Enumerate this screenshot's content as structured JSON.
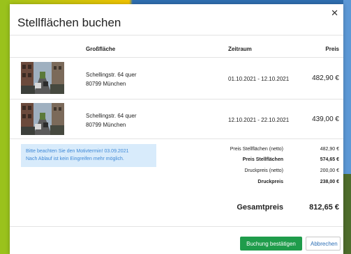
{
  "modal": {
    "title": "Stellflächen buchen",
    "close_icon": "close-icon"
  },
  "table": {
    "headers": {
      "area": "Großfläche",
      "period": "Zeitraum",
      "price": "Preis"
    },
    "rows": [
      {
        "address_line1": "Schellingstr. 64 quer",
        "address_line2": "80799 München",
        "period": "01.10.2021 - 12.10.2021",
        "price": "482,90 €",
        "image": "street-photo"
      },
      {
        "address_line1": "Schellingstr. 64 quer",
        "address_line2": "80799 München",
        "period": "12.10.2021 - 22.10.2021",
        "price": "439,00 €",
        "image": "street-photo"
      }
    ]
  },
  "notice": {
    "line1": "Bitte beachten Sie den Motivtermin! 03.09.2021",
    "line2": "Nach Ablauf ist kein Eingreifen mehr möglich."
  },
  "summary": [
    {
      "label": "Preis Stellflächen (netto)",
      "value": "482,90 €",
      "bold": false
    },
    {
      "label": "Preis Stellflächen",
      "value": "574,65 €",
      "bold": true
    },
    {
      "label": "Druckpreis (netto)",
      "value": "200,00 €",
      "bold": false
    },
    {
      "label": "Druckpreis",
      "value": "238,00 €",
      "bold": true
    }
  ],
  "total": {
    "label": "Gesamtpreis",
    "value": "812,65 €"
  },
  "buttons": {
    "confirm": "Buchung bestätigen",
    "cancel": "Abbrechen"
  },
  "colors": {
    "primary": "#1f9c4b",
    "notice_bg": "#d8ebfb",
    "notice_text": "#3e88d6",
    "link": "#2a6db5"
  }
}
